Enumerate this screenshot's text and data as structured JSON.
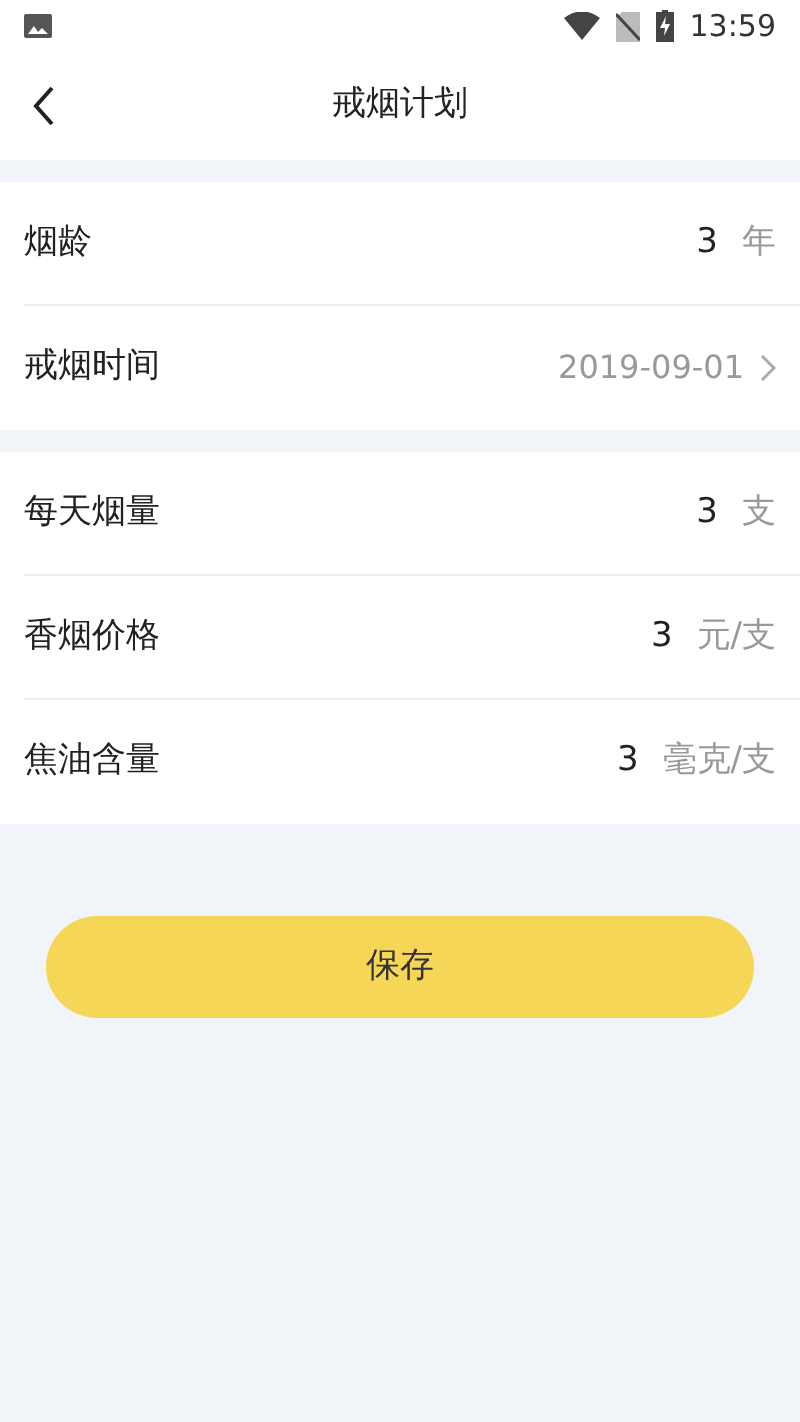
{
  "status_bar": {
    "time": "13:59"
  },
  "header": {
    "title": "戒烟计划"
  },
  "sections": [
    [
      {
        "kind": "number",
        "label": "烟龄",
        "value": "3",
        "unit": "年"
      },
      {
        "kind": "link",
        "label": "戒烟时间",
        "value": "2019-09-01"
      }
    ],
    [
      {
        "kind": "number",
        "label": "每天烟量",
        "value": "3",
        "unit": "支"
      },
      {
        "kind": "number",
        "label": "香烟价格",
        "value": "3",
        "unit": "元/支"
      },
      {
        "kind": "number",
        "label": "焦油含量",
        "value": "3",
        "unit": "毫克/支"
      }
    ]
  ],
  "save_button": {
    "label": "保存"
  }
}
